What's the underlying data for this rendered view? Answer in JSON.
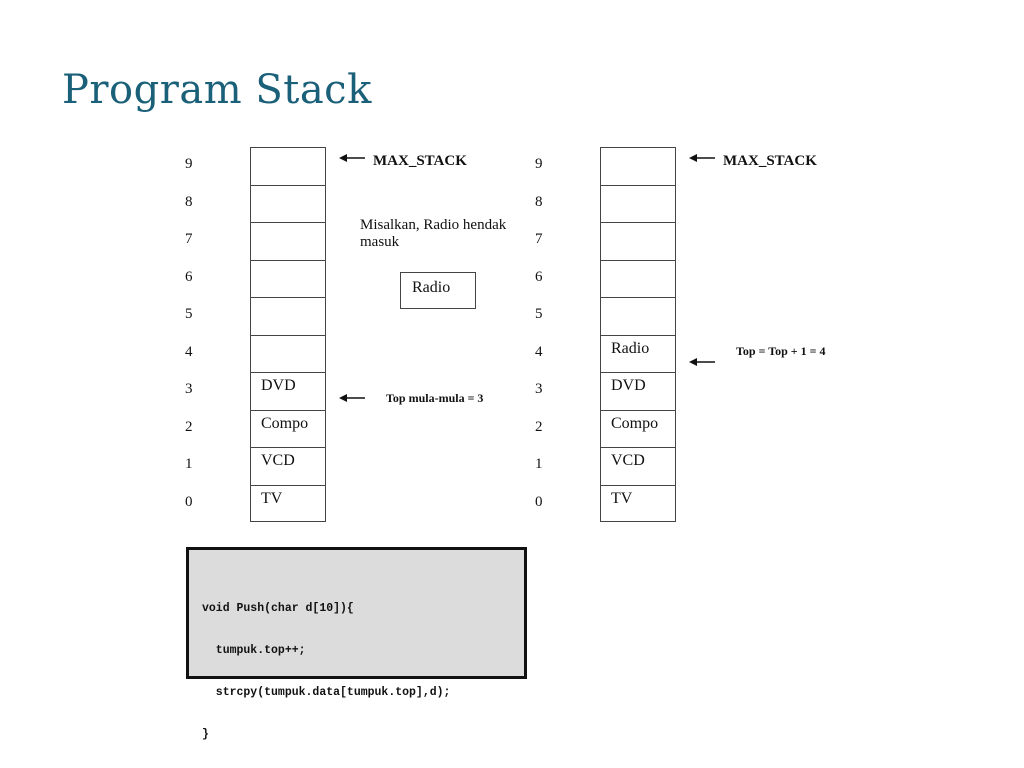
{
  "title": "Program Stack",
  "indices": [
    "9",
    "8",
    "7",
    "6",
    "5",
    "4",
    "3",
    "2",
    "1",
    "0"
  ],
  "left_stack": {
    "cells": [
      "",
      "",
      "",
      "",
      "",
      "",
      "DVD",
      "Compo",
      "VCD",
      "TV"
    ],
    "max_label": "MAX_STACK",
    "top_label": "Top mula-mula = 3",
    "note": "Misalkan, Radio hendak masuk",
    "incoming_item": "Radio"
  },
  "right_stack": {
    "cells": [
      "",
      "",
      "",
      "",
      "",
      "Radio",
      "DVD",
      "Compo",
      "VCD",
      "TV"
    ],
    "max_label": "MAX_STACK",
    "top_label": "Top = Top + 1 = 4"
  },
  "code": {
    "lines": [
      "void Push(char d[10]){",
      "  tumpuk.top++;",
      "  strcpy(tumpuk.data[tumpuk.top],d);",
      "}"
    ]
  },
  "colors": {
    "title": "#1b6079",
    "code_bg": "#dcdcdc"
  }
}
